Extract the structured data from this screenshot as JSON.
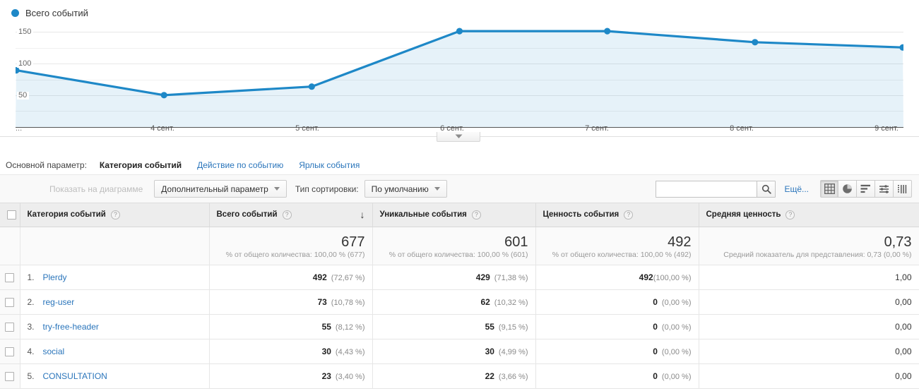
{
  "chart": {
    "legend_label": "Всего событий",
    "legend_color": "#1e88c7",
    "collapse_icon": "chevron-down-icon",
    "ellipsis": "..."
  },
  "chart_data": {
    "type": "area",
    "title": "Всего событий",
    "xlabel": "",
    "ylabel": "",
    "ylim": [
      0,
      160
    ],
    "yticks": [
      50,
      100,
      150
    ],
    "ytick_labels": [
      "50",
      "100",
      "150"
    ],
    "grid": true,
    "legend_position": "top-left",
    "categories": [
      "...",
      "4 сент.",
      "5 сент.",
      "6 сент.",
      "7 сент.",
      "8 сент.",
      "9 сент."
    ],
    "series": [
      {
        "name": "Всего событий",
        "color": "#1e88c7",
        "values": [
          88,
          50,
          63,
          148,
          148,
          131,
          123
        ]
      }
    ]
  },
  "dimension_bar": {
    "label": "Основной параметр:",
    "tabs": [
      {
        "label": "Категория событий",
        "active": true
      },
      {
        "label": "Действие по событию",
        "active": false
      },
      {
        "label": "Ярлык события",
        "active": false
      }
    ]
  },
  "controls": {
    "plot_rows_label": "Показать на диаграмме",
    "secondary_dimension_label": "Дополнительный параметр",
    "sort_type_label": "Тип сортировки:",
    "sort_type_value": "По умолчанию",
    "search_value": "",
    "search_placeholder": "",
    "search_icon": "search-icon",
    "more_link": "Ещё...",
    "view_icons": [
      {
        "name": "table-view-icon",
        "selected": true
      },
      {
        "name": "pie-chart-view-icon",
        "selected": false
      },
      {
        "name": "bar-chart-view-icon",
        "selected": false
      },
      {
        "name": "performance-view-icon",
        "selected": false
      },
      {
        "name": "pivot-view-icon",
        "selected": false
      }
    ]
  },
  "table": {
    "columns": [
      {
        "label": "Категория событий",
        "help": "?"
      },
      {
        "label": "Всего событий",
        "help": "?",
        "sorted": true,
        "sort_arrow": "↓"
      },
      {
        "label": "Уникальные события",
        "help": "?"
      },
      {
        "label": "Ценность события",
        "help": "?"
      },
      {
        "label": "Средняя ценность",
        "help": "?"
      }
    ],
    "summary": [
      {
        "value": "677",
        "sub": "% от общего количества: 100,00 % (677)"
      },
      {
        "value": "601",
        "sub": "% от общего количества: 100,00 % (601)"
      },
      {
        "value": "492",
        "sub": "% от общего количества: 100,00 % (492)"
      },
      {
        "value": "0,73",
        "sub": "Средний показатель для представления: 0,73 (0,00 %)"
      }
    ],
    "rows": [
      {
        "index": "1.",
        "name": "Plerdy",
        "total": "492",
        "total_pct": "(72,67 %)",
        "unique": "429",
        "unique_pct": "(71,38 %)",
        "value": "492",
        "value_pct": "(100,00 %)",
        "avg": "1,00"
      },
      {
        "index": "2.",
        "name": "reg-user",
        "total": "73",
        "total_pct": "(10,78 %)",
        "unique": "62",
        "unique_pct": "(10,32 %)",
        "value": "0",
        "value_pct": "(0,00 %)",
        "avg": "0,00"
      },
      {
        "index": "3.",
        "name": "try-free-header",
        "total": "55",
        "total_pct": "(8,12 %)",
        "unique": "55",
        "unique_pct": "(9,15 %)",
        "value": "0",
        "value_pct": "(0,00 %)",
        "avg": "0,00"
      },
      {
        "index": "4.",
        "name": "social",
        "total": "30",
        "total_pct": "(4,43 %)",
        "unique": "30",
        "unique_pct": "(4,99 %)",
        "value": "0",
        "value_pct": "(0,00 %)",
        "avg": "0,00"
      },
      {
        "index": "5.",
        "name": "CONSULTATION",
        "total": "23",
        "total_pct": "(3,40 %)",
        "unique": "22",
        "unique_pct": "(3,66 %)",
        "value": "0",
        "value_pct": "(0,00 %)",
        "avg": "0,00"
      }
    ]
  }
}
